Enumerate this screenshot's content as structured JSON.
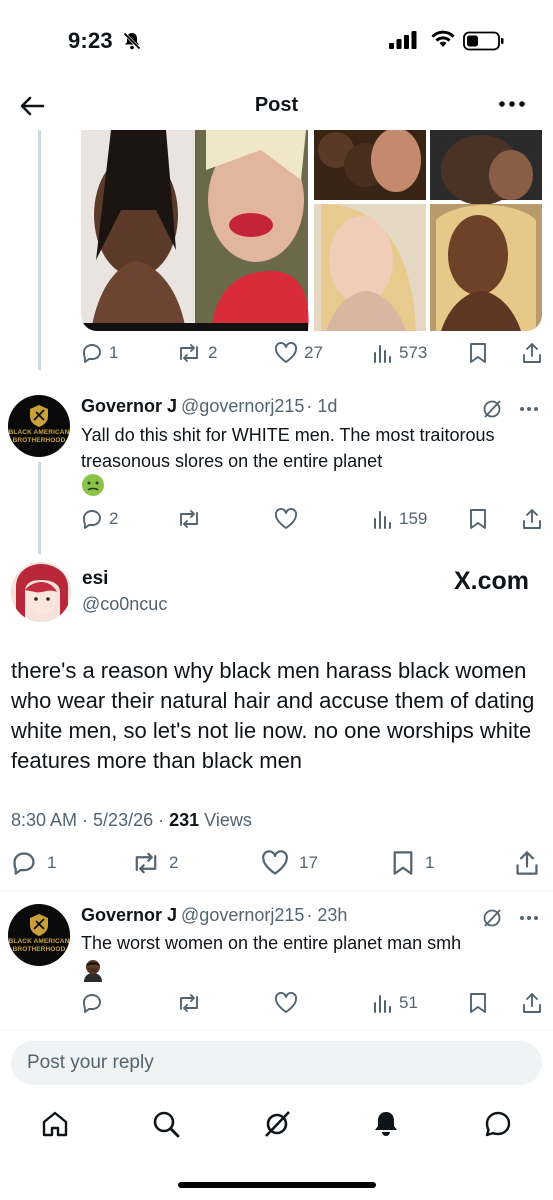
{
  "status_bar": {
    "time": "9:23"
  },
  "header": {
    "title": "Post"
  },
  "first_tweet_stats": {
    "replies": "1",
    "reposts": "2",
    "likes": "27",
    "views": "573"
  },
  "reply1": {
    "name": "Governor J",
    "handle": "@governorj215",
    "age": "· 1d",
    "text": "Yall do this shit for WHITE men. The most traitorous treasonous slores on the entire planet",
    "emoji": "nauseated-face",
    "stats": {
      "replies": "2",
      "views": "159"
    },
    "avatar_text": {
      "line1": "BLACK AMERICAN",
      "line2": "BROTHERHOOD"
    }
  },
  "main_post": {
    "name": "esi",
    "handle": "@co0ncuc",
    "watermark": "X.com",
    "text": "there's a reason why black men harass black women who wear their natural hair and accuse them of dating white men, so let's not lie now. no one worships white features more than black men",
    "time": "8:30 AM",
    "date": "5/23/26",
    "views_count": "231",
    "views_label": "Views",
    "stats": {
      "replies": "1",
      "reposts": "2",
      "likes": "17",
      "bookmarks": "1"
    }
  },
  "reply2": {
    "name": "Governor J",
    "handle": "@governorj215",
    "age": "· 23h",
    "text": "The worst women on the entire planet man smh",
    "emoji": "man-facepalming",
    "stats": {
      "views": "51"
    },
    "avatar_text": {
      "line1": "BLACK AMERICAN",
      "line2": "BROTHERHOOD"
    }
  },
  "composer": {
    "placeholder": "Post your reply"
  },
  "tabbar": {
    "items": [
      "home-icon",
      "search-icon",
      "grok-icon",
      "notifications-icon",
      "messages-icon"
    ]
  },
  "colors": {
    "text": "#0f1419",
    "muted": "#536471",
    "divider": "#eff3f4",
    "thread_line": "#cfd9de",
    "gold": "#c9a13b"
  }
}
